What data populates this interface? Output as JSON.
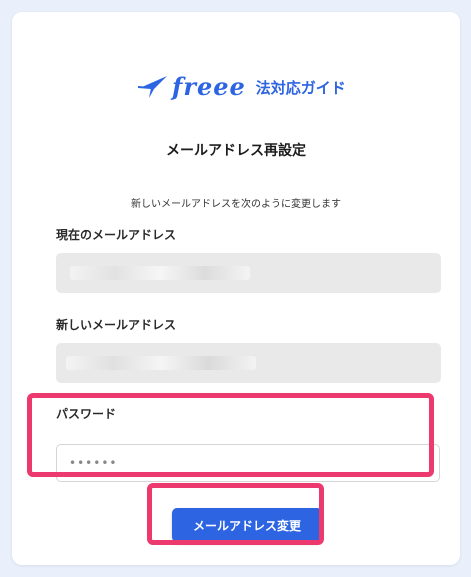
{
  "brand": {
    "word": "freee",
    "suffix": "法対応ガイド",
    "color": "#2d64e1"
  },
  "page": {
    "title": "メールアドレス再設定",
    "description": "新しいメールアドレスを次のように変更します"
  },
  "form": {
    "current_email": {
      "label": "現在のメールアドレス",
      "value": ""
    },
    "new_email": {
      "label": "新しいメールアドレス",
      "value": ""
    },
    "password": {
      "label": "パスワード",
      "value": "••••••"
    },
    "submit_label": "メールアドレス変更"
  },
  "highlight_color": "#ec3a6f"
}
